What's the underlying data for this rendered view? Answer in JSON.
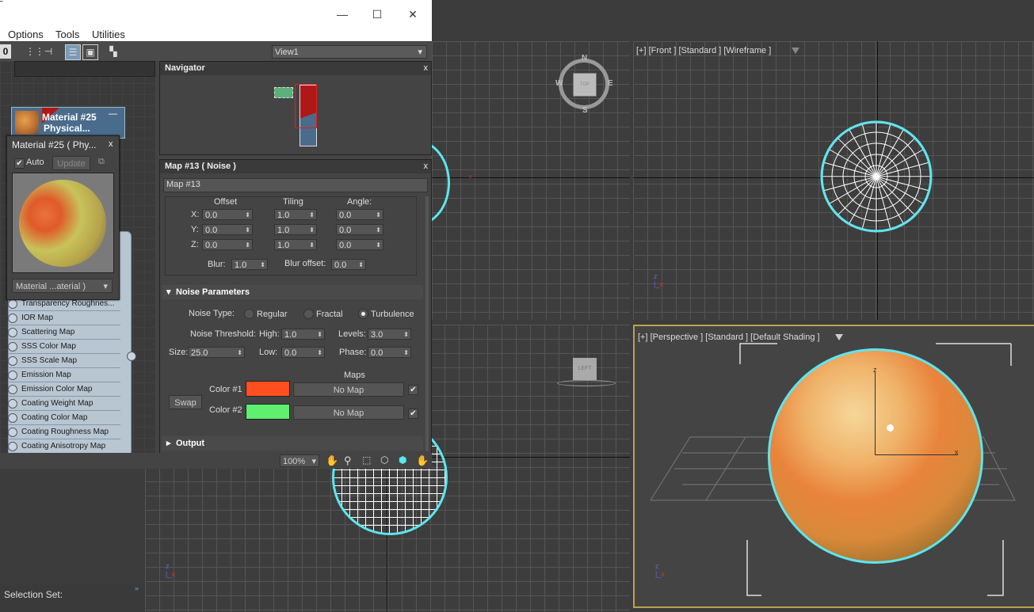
{
  "window": {
    "title_glyph": "˜",
    "menu": [
      "Options",
      "Tools",
      "Utilities"
    ],
    "win_buttons": {
      "minimize": "—",
      "maximize": "☐",
      "close": "✕"
    }
  },
  "toolbar": {
    "view_select": "View1",
    "zero_label": "0"
  },
  "node": {
    "title_line1": "Material #25",
    "title_line2": "Physical...",
    "collapse": "—"
  },
  "preview": {
    "title": "Material #25  ( Phy...",
    "close": "x",
    "auto_label": "Auto",
    "update_label": "Update",
    "dropdown": "Material ...aterial )"
  },
  "map_slots": [
    "Transparency Roughnes...",
    "IOR Map",
    "Scattering Map",
    "SSS Color Map",
    "SSS Scale Map",
    "Emission Map",
    "Emission Color Map",
    "Coating Weight Map",
    "Coating Color Map",
    "Coating Roughness Map",
    "Coating Anisotropy Map"
  ],
  "navigator": {
    "title": "Navigator",
    "close": "x"
  },
  "map_panel": {
    "title": "Map #13  ( Noise )",
    "close": "x",
    "name_field": "Map #13",
    "coords": {
      "offset_label": "Offset",
      "tiling_label": "Tiling",
      "angle_label": "Angle:",
      "rows": [
        {
          "axis": "X:",
          "offset": "0.0",
          "tiling": "1.0",
          "angle": "0.0"
        },
        {
          "axis": "Y:",
          "offset": "0.0",
          "tiling": "1.0",
          "angle": "0.0"
        },
        {
          "axis": "Z:",
          "offset": "0.0",
          "tiling": "1.0",
          "angle": "0.0"
        }
      ],
      "blur_label": "Blur:",
      "blur": "1.0",
      "blur_offset_label": "Blur offset:",
      "blur_offset": "0.0"
    },
    "noise": {
      "section_title": "Noise Parameters",
      "noise_type_label": "Noise Type:",
      "types": [
        "Regular",
        "Fractal",
        "Turbulence"
      ],
      "selected_type": "Turbulence",
      "threshold_label": "Noise Threshold:",
      "high_label": "High:",
      "high": "1.0",
      "levels_label": "Levels:",
      "levels": "3.0",
      "size_label": "Size:",
      "size": "25.0",
      "low_label": "Low:",
      "low": "0.0",
      "phase_label": "Phase:",
      "phase": "0.0",
      "maps_label": "Maps",
      "swap_label": "Swap",
      "color1_label": "Color #1",
      "color1": "#ff4f1f",
      "color2_label": "Color #2",
      "color2": "#5ef06e",
      "map1": "No Map",
      "map2": "No Map"
    },
    "output_title": "Output"
  },
  "bottom_bar": {
    "zoom": "100%"
  },
  "status": {
    "selection_set": "Selection Set:"
  },
  "viewports": {
    "front": "[+] [Front ] [Standard ] [Wireframe ]",
    "perspective": "[+] [Perspective ] [Standard ] [Default Shading ]",
    "viewcube_top": "TOP",
    "viewcube_left": "LEFT",
    "compass": {
      "n": "N",
      "s": "S",
      "e": "E",
      "w": "W"
    }
  },
  "colors": {
    "selection_cyan": "#5ce6f0",
    "active_border": "#b9a34a"
  }
}
